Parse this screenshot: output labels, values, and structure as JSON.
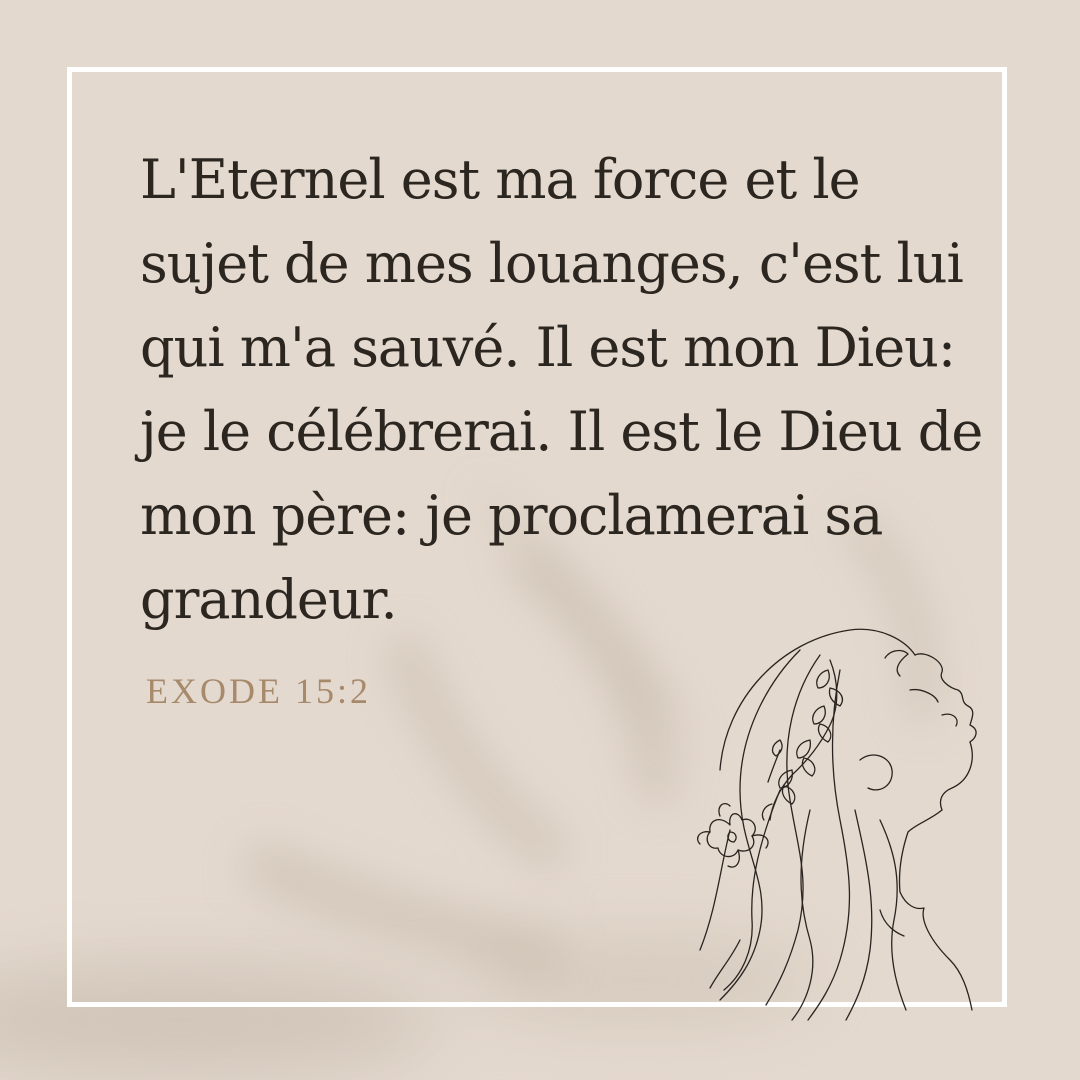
{
  "verse": {
    "lines": [
      "L'Eternel est ma force et le",
      "sujet de mes louanges, c'est lui",
      "qui m'a sauvé. Il est mon Dieu:",
      "je le célébrerai. Il est le Dieu de",
      "mon père: je proclamerai sa",
      "grandeur."
    ]
  },
  "reference": "EXODE 15:2",
  "colors": {
    "background": "#e4d9ce",
    "frame": "#ffffff",
    "text": "#2c2621",
    "reference": "#a7896b",
    "lineart": "#2a2420"
  },
  "illustration": {
    "icon": "woman-profile-line-art-icon"
  }
}
